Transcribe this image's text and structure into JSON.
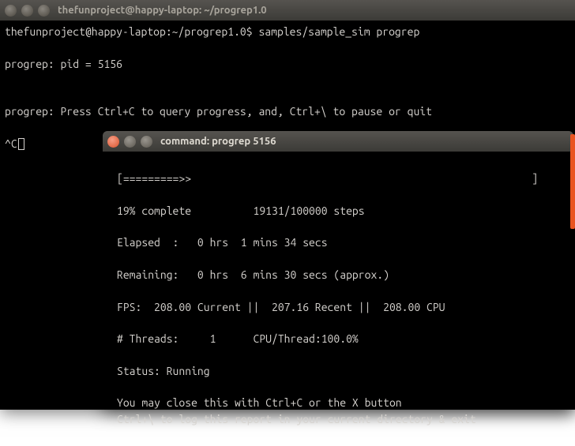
{
  "main": {
    "title": "thefunproject@happy-laptop: ~/progrep1.0",
    "prompt": "thefunproject@happy-laptop:~/progrep1.0$ samples/sample_sim progrep",
    "line_pid": "progrep: pid = 5156",
    "line_hint": "progrep: Press Ctrl+C to query progress, and, Ctrl+\\ to pause or quit",
    "line_ctrlc": "^C"
  },
  "sub": {
    "title": "command: progrep 5156",
    "bar_line": "[=========>>                                                       ]",
    "complete": "19% complete          19131/100000 steps",
    "elapsed": "Elapsed  :   0 hrs  1 mins 34 secs",
    "remaining": "Remaining:   0 hrs  6 mins 30 secs (approx.)",
    "fps": "FPS:  208.00 Current ||  207.16 Recent ||  208.00 CPU",
    "threads": "# Threads:     1      CPU/Thread:100.0%",
    "status": "Status: Running",
    "hint1": "You may close this with Ctrl+C or the X button",
    "hint2": "Ctrl+\\ to log this report in your current directory & exit"
  }
}
